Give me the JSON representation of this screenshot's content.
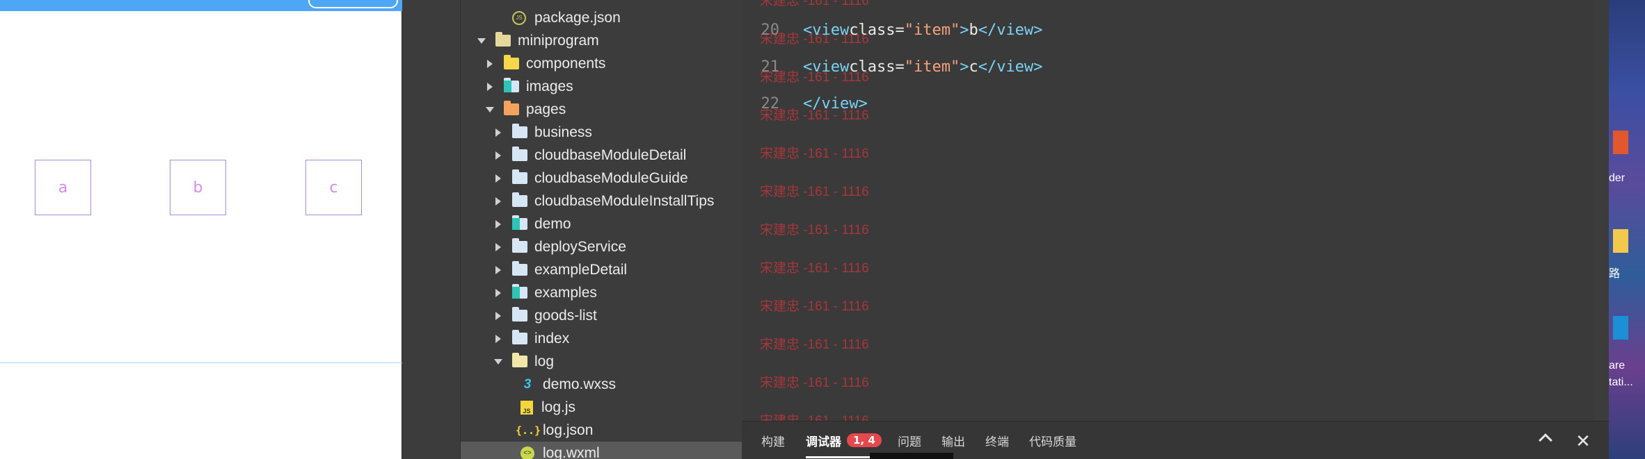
{
  "simulator": {
    "items": [
      "a",
      "b",
      "c"
    ]
  },
  "explorer": {
    "rows": [
      {
        "label": "package.json",
        "type": "file-pkg",
        "indent": 2,
        "arrow": "none"
      },
      {
        "label": "miniprogram",
        "type": "folder-open",
        "indent": 0,
        "arrow": "down"
      },
      {
        "label": "components",
        "type": "folder-yellow",
        "indent": 1,
        "arrow": "right"
      },
      {
        "label": "images",
        "type": "folder-teal",
        "indent": 1,
        "arrow": "right"
      },
      {
        "label": "pages",
        "type": "folder-orange",
        "indent": 1,
        "arrow": "down"
      },
      {
        "label": "business",
        "type": "folder",
        "indent": 2,
        "arrow": "right"
      },
      {
        "label": "cloudbaseModuleDetail",
        "type": "folder",
        "indent": 2,
        "arrow": "right"
      },
      {
        "label": "cloudbaseModuleGuide",
        "type": "folder",
        "indent": 2,
        "arrow": "right"
      },
      {
        "label": "cloudbaseModuleInstallTips",
        "type": "folder",
        "indent": 2,
        "arrow": "right"
      },
      {
        "label": "demo",
        "type": "folder-teal",
        "indent": 2,
        "arrow": "right"
      },
      {
        "label": "deployService",
        "type": "folder",
        "indent": 2,
        "arrow": "right"
      },
      {
        "label": "exampleDetail",
        "type": "folder",
        "indent": 2,
        "arrow": "right"
      },
      {
        "label": "examples",
        "type": "folder-teal",
        "indent": 2,
        "arrow": "right"
      },
      {
        "label": "goods-list",
        "type": "folder",
        "indent": 2,
        "arrow": "right"
      },
      {
        "label": "index",
        "type": "folder",
        "indent": 2,
        "arrow": "right"
      },
      {
        "label": "log",
        "type": "folder-lightopen",
        "indent": 2,
        "arrow": "down"
      },
      {
        "label": "demo.wxss",
        "type": "file-css",
        "indent": 3,
        "arrow": "none"
      },
      {
        "label": "log.js",
        "type": "file-js",
        "indent": 3,
        "arrow": "none"
      },
      {
        "label": "log.json",
        "type": "file-json",
        "indent": 3,
        "arrow": "none"
      },
      {
        "label": "log.wxml",
        "type": "file-wxml",
        "indent": 3,
        "arrow": "none",
        "selected": true
      }
    ]
  },
  "editor": {
    "lines": [
      {
        "num": "20",
        "open": "<view",
        "attr": " class=",
        "str": "\"item\"",
        "close": ">",
        "text": "b",
        "end": "</view>"
      },
      {
        "num": "21",
        "open": "<view",
        "attr": " class=",
        "str": "\"item\"",
        "close": ">",
        "text": "c",
        "end": "</view>"
      },
      {
        "num": "22",
        "end": "</view>"
      }
    ],
    "watermark": "宋建忠 -161 - 1116"
  },
  "bottom_panel": {
    "tabs": [
      "构建",
      "调试器",
      "问题",
      "输出",
      "终端",
      "代码质量"
    ],
    "active_tab": "调试器",
    "badge": "1, 4"
  },
  "desktop": {
    "labels": [
      "der",
      "路",
      "are",
      "tati..."
    ]
  }
}
